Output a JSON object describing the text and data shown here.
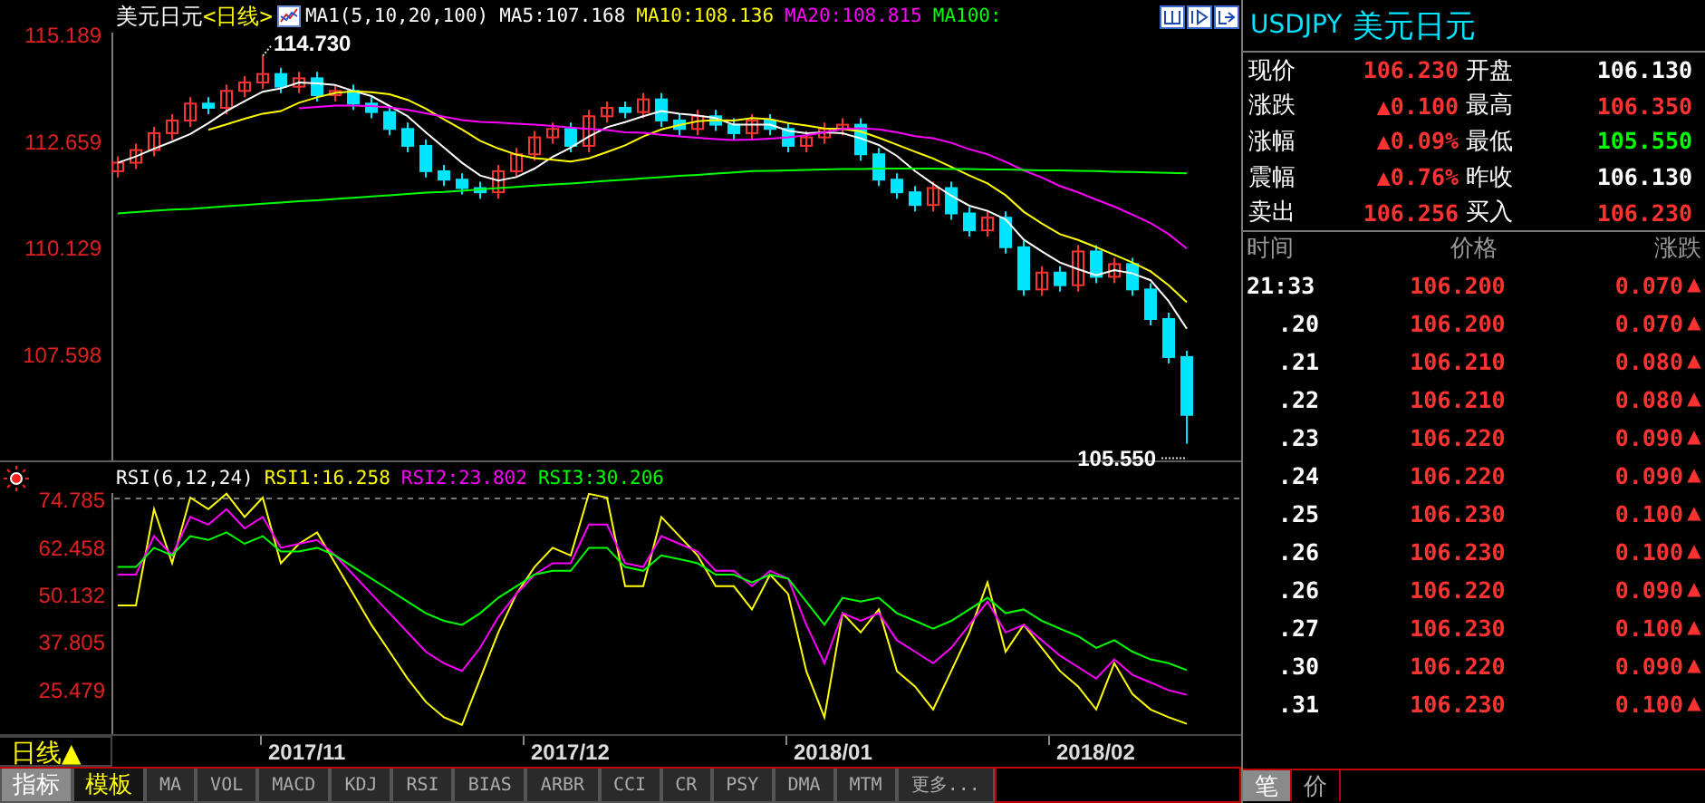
{
  "header": {
    "symbol": "美元日元",
    "period": "<日线>",
    "indicator": "MA1(5,10,20,100)",
    "ma_values": [
      {
        "text": "MA5:107.168",
        "color": "#ffffff"
      },
      {
        "text": "MA10:108.136",
        "color": "#ffff00"
      },
      {
        "text": "MA20:108.815",
        "color": "#ff00ff"
      },
      {
        "text": "MA100:",
        "color": "#00ff00"
      }
    ]
  },
  "price_chart": {
    "chart_data": {
      "type": "candlestick",
      "ylim": [
        105.11,
        115.28
      ],
      "ohlc": [
        [
          112.0,
          112.35,
          111.85,
          112.2
        ],
        [
          112.2,
          112.65,
          112.05,
          112.5
        ],
        [
          112.5,
          113.05,
          112.35,
          112.9
        ],
        [
          112.9,
          113.35,
          112.75,
          113.2
        ],
        [
          113.2,
          113.75,
          113.05,
          113.6
        ],
        [
          113.6,
          113.75,
          113.35,
          113.5
        ],
        [
          113.5,
          114.05,
          113.35,
          113.9
        ],
        [
          113.9,
          114.25,
          113.75,
          114.1
        ],
        [
          114.1,
          114.73,
          113.95,
          114.3
        ],
        [
          114.3,
          114.45,
          113.85,
          114.0
        ],
        [
          114.0,
          114.35,
          113.85,
          114.2
        ],
        [
          114.2,
          114.35,
          113.65,
          113.8
        ],
        [
          113.8,
          114.05,
          113.65,
          113.9
        ],
        [
          113.9,
          114.05,
          113.45,
          113.6
        ],
        [
          113.6,
          113.75,
          113.25,
          113.4
        ],
        [
          113.4,
          113.55,
          112.85,
          113.0
        ],
        [
          113.0,
          113.15,
          112.45,
          112.6
        ],
        [
          112.6,
          112.75,
          111.85,
          112.0
        ],
        [
          112.0,
          112.15,
          111.65,
          111.8
        ],
        [
          111.8,
          111.95,
          111.45,
          111.6
        ],
        [
          111.6,
          111.75,
          111.35,
          111.5
        ],
        [
          111.5,
          112.15,
          111.35,
          112.0
        ],
        [
          112.0,
          112.55,
          111.85,
          112.4
        ],
        [
          112.4,
          112.95,
          112.25,
          112.8
        ],
        [
          112.8,
          113.15,
          112.65,
          113.0
        ],
        [
          113.0,
          113.15,
          112.45,
          112.6
        ],
        [
          112.6,
          113.45,
          112.45,
          113.3
        ],
        [
          113.3,
          113.65,
          113.15,
          113.5
        ],
        [
          113.5,
          113.65,
          113.25,
          113.4
        ],
        [
          113.4,
          113.85,
          113.25,
          113.7
        ],
        [
          113.7,
          113.85,
          113.05,
          113.2
        ],
        [
          113.2,
          113.35,
          112.85,
          113.0
        ],
        [
          113.0,
          113.45,
          112.85,
          113.3
        ],
        [
          113.3,
          113.45,
          112.95,
          113.1
        ],
        [
          113.1,
          113.25,
          112.75,
          112.9
        ],
        [
          112.9,
          113.35,
          112.75,
          113.2
        ],
        [
          113.2,
          113.35,
          112.85,
          113.0
        ],
        [
          113.0,
          113.15,
          112.45,
          112.6
        ],
        [
          112.6,
          112.95,
          112.45,
          112.8
        ],
        [
          112.8,
          113.15,
          112.65,
          113.0
        ],
        [
          113.0,
          113.25,
          112.85,
          113.1
        ],
        [
          113.1,
          113.25,
          112.25,
          112.4
        ],
        [
          112.4,
          112.55,
          111.65,
          111.8
        ],
        [
          111.8,
          111.95,
          111.35,
          111.5
        ],
        [
          111.5,
          111.65,
          111.05,
          111.2
        ],
        [
          111.2,
          111.75,
          111.05,
          111.6
        ],
        [
          111.6,
          111.75,
          110.85,
          111.0
        ],
        [
          111.0,
          111.15,
          110.45,
          110.6
        ],
        [
          110.6,
          111.05,
          110.45,
          110.9
        ],
        [
          110.9,
          111.05,
          110.05,
          110.2
        ],
        [
          110.2,
          110.35,
          109.05,
          109.2
        ],
        [
          109.2,
          109.75,
          109.05,
          109.6
        ],
        [
          109.6,
          109.75,
          109.15,
          109.3
        ],
        [
          109.3,
          110.25,
          109.15,
          110.1
        ],
        [
          110.1,
          110.25,
          109.35,
          109.5
        ],
        [
          109.5,
          109.95,
          109.35,
          109.8
        ],
        [
          109.8,
          109.95,
          109.05,
          109.2
        ],
        [
          109.2,
          109.35,
          108.35,
          108.5
        ],
        [
          108.5,
          108.65,
          107.45,
          107.6
        ],
        [
          107.6,
          107.75,
          105.55,
          106.23
        ]
      ],
      "yticks": [
        {
          "value": 115.189,
          "label": "115.189"
        },
        {
          "value": 112.659,
          "label": "112.659"
        },
        {
          "value": 110.129,
          "label": "110.129"
        },
        {
          "value": 107.598,
          "label": "107.598"
        }
      ],
      "annotations": [
        "114.730",
        "105.550"
      ]
    },
    "moving_averages": {
      "chart_data": {
        "type": "line",
        "ylim": [
          105.11,
          115.28
        ],
        "series": [
          {
            "color": "#ffffff",
            "values": [
              112.2,
              112.35,
              112.53,
              112.7,
              112.88,
              113.14,
              113.42,
              113.66,
              113.88,
              113.96,
              114.1,
              114.08,
              114.04,
              113.9,
              113.78,
              113.54,
              113.3,
              112.92,
              112.56,
              112.2,
              111.9,
              111.78,
              111.86,
              112.06,
              112.34,
              112.56,
              112.82,
              113.04,
              113.16,
              113.3,
              113.42,
              113.36,
              113.32,
              113.26,
              113.1,
              113.1,
              113.1,
              112.96,
              112.9,
              112.92,
              112.9,
              112.78,
              112.62,
              112.36,
              112.0,
              111.7,
              111.42,
              111.18,
              111.06,
              110.86,
              110.38,
              110.1,
              109.84,
              109.68,
              109.54,
              109.66,
              109.58,
              109.42,
              108.92,
              108.27
            ]
          },
          {
            "color": "#ffff00",
            "values": [
              null,
              null,
              null,
              null,
              null,
              112.98,
              113.11,
              113.24,
              113.36,
              113.42,
              113.62,
              113.75,
              113.85,
              113.89,
              113.87,
              113.82,
              113.69,
              113.48,
              113.23,
              112.99,
              112.72,
              112.54,
              112.39,
              112.31,
              112.27,
              112.23,
              112.3,
              112.45,
              112.61,
              112.82,
              112.99,
              113.09,
              113.18,
              113.21,
              113.2,
              113.26,
              113.23,
              113.14,
              113.08,
              113.01,
              113.0,
              112.94,
              112.79,
              112.63,
              112.46,
              112.3,
              112.1,
              111.9,
              111.71,
              111.43,
              111.04,
              110.76,
              110.51,
              110.37,
              110.2,
              110.02,
              109.84,
              109.63,
              109.3,
              108.9
            ]
          },
          {
            "color": "#ff00ff",
            "values": [
              null,
              null,
              null,
              null,
              null,
              null,
              null,
              null,
              null,
              null,
              113.49,
              113.52,
              113.55,
              113.55,
              113.54,
              113.51,
              113.45,
              113.37,
              113.29,
              113.21,
              113.17,
              113.15,
              113.12,
              113.1,
              113.07,
              113.03,
              113.0,
              112.97,
              112.92,
              112.91,
              112.86,
              112.82,
              112.79,
              112.76,
              112.74,
              112.75,
              112.77,
              112.8,
              112.85,
              112.92,
              113.0,
              113.02,
              112.99,
              112.92,
              112.83,
              112.78,
              112.67,
              112.52,
              112.4,
              112.22,
              112.02,
              111.85,
              111.65,
              111.5,
              111.33,
              111.16,
              110.97,
              110.77,
              110.51,
              110.17
            ]
          },
          {
            "color": "#00ff00",
            "values": [
              111.0,
              111.03,
              111.06,
              111.09,
              111.11,
              111.14,
              111.17,
              111.2,
              111.23,
              111.26,
              111.29,
              111.31,
              111.34,
              111.37,
              111.4,
              111.43,
              111.46,
              111.49,
              111.51,
              111.54,
              111.57,
              111.6,
              111.63,
              111.66,
              111.69,
              111.71,
              111.74,
              111.77,
              111.8,
              111.83,
              111.86,
              111.89,
              111.91,
              111.94,
              111.97,
              112.0,
              112.01,
              112.02,
              112.03,
              112.04,
              112.05,
              112.05,
              112.06,
              112.06,
              112.06,
              112.06,
              112.05,
              112.05,
              112.04,
              112.04,
              112.03,
              112.02,
              112.02,
              112.01,
              112.0,
              111.99,
              111.98,
              111.97,
              111.96,
              111.95
            ]
          }
        ]
      }
    }
  },
  "rsi_panel": {
    "title": "RSI(6,12,24)",
    "values": [
      {
        "text": "RSI1:16.258",
        "color": "#ffff00"
      },
      {
        "text": "RSI2:23.802",
        "color": "#ff00ff"
      },
      {
        "text": "RSI3:30.206",
        "color": "#00ff00"
      }
    ],
    "chart_data": {
      "type": "line",
      "ylim": [
        13.6,
        76.2
      ],
      "yticks": [
        {
          "value": 74.785,
          "label": "74.785"
        },
        {
          "value": 62.458,
          "label": "62.458"
        },
        {
          "value": 50.132,
          "label": "50.132"
        },
        {
          "value": 37.805,
          "label": "37.805"
        },
        {
          "value": 25.479,
          "label": "25.479"
        }
      ],
      "series": [
        {
          "color": "#ffff00",
          "values": [
            47,
            47,
            72,
            58,
            75,
            72,
            76,
            70,
            75,
            58,
            63,
            66,
            58,
            50,
            42,
            35,
            28,
            22,
            18,
            16,
            28,
            40,
            50,
            57,
            62,
            60,
            76,
            75,
            52,
            52,
            70,
            65,
            60,
            52,
            52,
            46,
            55,
            50,
            30,
            18,
            45,
            40,
            46,
            30,
            26,
            20,
            30,
            40,
            53,
            35,
            42,
            36,
            30,
            26,
            20,
            32,
            24,
            20,
            18,
            16.3
          ]
        },
        {
          "color": "#ff00ff",
          "values": [
            55,
            55,
            65,
            60,
            70,
            68,
            72,
            67,
            70,
            62,
            63,
            64,
            60,
            55,
            50,
            45,
            40,
            35,
            32,
            30,
            36,
            44,
            50,
            55,
            58,
            58,
            68,
            68,
            58,
            57,
            65,
            63,
            61,
            56,
            56,
            52,
            56,
            54,
            42,
            32,
            45,
            43,
            45,
            38,
            35,
            32,
            36,
            42,
            48,
            40,
            42,
            38,
            34,
            31,
            28,
            33,
            29,
            27,
            25,
            23.8
          ]
        },
        {
          "color": "#00ff00",
          "values": [
            57,
            57,
            62,
            60,
            65,
            64,
            66,
            63,
            65,
            61,
            61,
            62,
            60,
            57,
            54,
            51,
            48,
            45,
            43,
            42,
            45,
            49,
            52,
            55,
            56,
            56,
            62,
            62,
            57,
            56,
            60,
            59,
            58,
            55,
            55,
            53,
            55,
            54,
            48,
            42,
            49,
            48,
            49,
            45,
            43,
            41,
            43,
            46,
            49,
            45,
            46,
            43,
            41,
            39,
            36,
            38,
            35,
            33,
            32,
            30.2
          ]
        }
      ]
    }
  },
  "date_axis": [
    "2017/11",
    "2017/12",
    "2018/01",
    "2018/02"
  ],
  "period_button": {
    "label": "日线▲"
  },
  "indicator_tabs": [
    {
      "label": "指标",
      "kind": "mode",
      "selected": true
    },
    {
      "label": "模板",
      "kind": "mode",
      "selected": false
    },
    {
      "label": "MA",
      "kind": "indicator",
      "selected": false
    },
    {
      "label": "VOL",
      "kind": "indicator",
      "selected": false
    },
    {
      "label": "MACD",
      "kind": "indicator",
      "selected": false
    },
    {
      "label": "KDJ",
      "kind": "indicator",
      "selected": false
    },
    {
      "label": "RSI",
      "kind": "indicator",
      "selected": false
    },
    {
      "label": "BIAS",
      "kind": "indicator",
      "selected": false
    },
    {
      "label": "ARBR",
      "kind": "indicator",
      "selected": false
    },
    {
      "label": "CCI",
      "kind": "indicator",
      "selected": false
    },
    {
      "label": "CR",
      "kind": "indicator",
      "selected": false
    },
    {
      "label": "PSY",
      "kind": "indicator",
      "selected": false
    },
    {
      "label": "DMA",
      "kind": "indicator",
      "selected": false
    },
    {
      "label": "MTM",
      "kind": "indicator",
      "selected": false
    },
    {
      "label": "更多...",
      "kind": "indicator",
      "selected": false
    }
  ],
  "quote": {
    "code": "USDJPY",
    "name": "美元日元",
    "fields": [
      {
        "label": "现价",
        "value": "106.230",
        "color": "#ff3232"
      },
      {
        "label": "开盘",
        "value": "106.130",
        "color": "#ffffff"
      },
      {
        "label": "涨跌",
        "value": "▲0.100",
        "color": "#ff3232"
      },
      {
        "label": "最高",
        "value": "106.350",
        "color": "#ff3232"
      },
      {
        "label": "涨幅",
        "value": "▲0.09%",
        "color": "#ff3232"
      },
      {
        "label": "最低",
        "value": "105.550",
        "color": "#00ff00"
      },
      {
        "label": "震幅",
        "value": "▲0.76%",
        "color": "#ff3232"
      },
      {
        "label": "昨收",
        "value": "106.130",
        "color": "#ffffff"
      },
      {
        "label": "卖出",
        "value": "106.256",
        "color": "#ff3232"
      },
      {
        "label": "买入",
        "value": "106.230",
        "color": "#ff3232"
      }
    ]
  },
  "trades": {
    "columns": [
      "时间",
      "价格",
      "涨跌"
    ],
    "rows": [
      {
        "time": "21:33",
        "price": "106.200",
        "change": "0.070",
        "arrow": "▲"
      },
      {
        "time": ".20",
        "price": "106.200",
        "change": "0.070",
        "arrow": "▲"
      },
      {
        "time": ".21",
        "price": "106.210",
        "change": "0.080",
        "arrow": "▲"
      },
      {
        "time": ".22",
        "price": "106.210",
        "change": "0.080",
        "arrow": "▲"
      },
      {
        "time": ".23",
        "price": "106.220",
        "change": "0.090",
        "arrow": "▲"
      },
      {
        "time": ".24",
        "price": "106.220",
        "change": "0.090",
        "arrow": "▲"
      },
      {
        "time": ".25",
        "price": "106.230",
        "change": "0.100",
        "arrow": "▲"
      },
      {
        "time": ".26",
        "price": "106.230",
        "change": "0.100",
        "arrow": "▲"
      },
      {
        "time": ".26",
        "price": "106.220",
        "change": "0.090",
        "arrow": "▲"
      },
      {
        "time": ".27",
        "price": "106.230",
        "change": "0.100",
        "arrow": "▲"
      },
      {
        "time": ".30",
        "price": "106.220",
        "change": "0.090",
        "arrow": "▲"
      },
      {
        "time": ".31",
        "price": "106.230",
        "change": "0.100",
        "arrow": "▲"
      }
    ],
    "tabs": [
      {
        "label": "笔",
        "selected": true
      },
      {
        "label": "价",
        "selected": false
      }
    ]
  }
}
